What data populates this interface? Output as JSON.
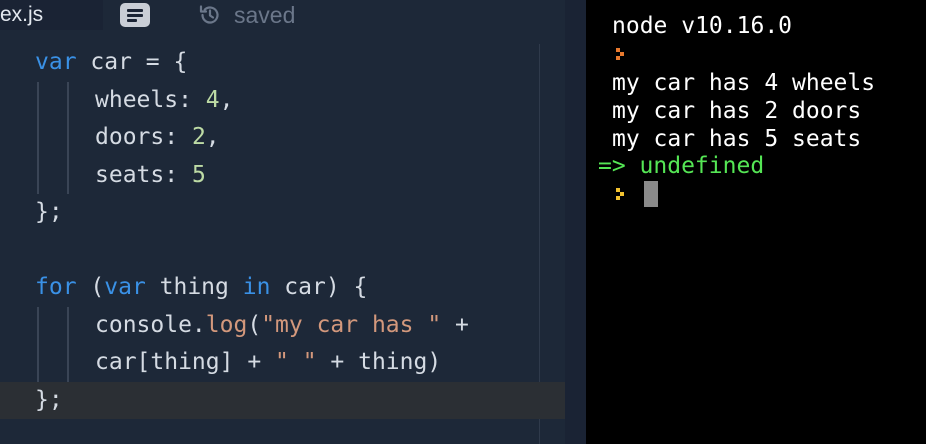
{
  "editor": {
    "active_tab": "ex.js",
    "saved_label": "saved",
    "lines": [
      {
        "tokens": [
          {
            "t": "var",
            "c": "kw"
          },
          {
            "t": " car = {",
            "c": "plain"
          }
        ]
      },
      {
        "tokens": [
          {
            "t": "wheels: ",
            "c": "plain"
          },
          {
            "t": "4",
            "c": "num"
          },
          {
            "t": ",",
            "c": "plain"
          }
        ]
      },
      {
        "tokens": [
          {
            "t": "doors: ",
            "c": "plain"
          },
          {
            "t": "2",
            "c": "num"
          },
          {
            "t": ",",
            "c": "plain"
          }
        ]
      },
      {
        "tokens": [
          {
            "t": "seats: ",
            "c": "plain"
          },
          {
            "t": "5",
            "c": "num"
          }
        ]
      },
      {
        "tokens": [
          {
            "t": "};",
            "c": "plain"
          }
        ]
      },
      {
        "tokens": []
      },
      {
        "tokens": [
          {
            "t": "for",
            "c": "kw"
          },
          {
            "t": " (",
            "c": "plain"
          },
          {
            "t": "var",
            "c": "kw"
          },
          {
            "t": " thing ",
            "c": "plain"
          },
          {
            "t": "in",
            "c": "kw"
          },
          {
            "t": " car) {",
            "c": "plain"
          }
        ]
      },
      {
        "tokens": [
          {
            "t": "console.",
            "c": "plain"
          },
          {
            "t": "log",
            "c": "str"
          },
          {
            "t": "(",
            "c": "plain"
          },
          {
            "t": "\"my car has \"",
            "c": "str"
          },
          {
            "t": " +",
            "c": "plain"
          }
        ]
      },
      {
        "tokens": [
          {
            "t": "car[thing] + ",
            "c": "plain"
          },
          {
            "t": "\" \"",
            "c": "str"
          },
          {
            "t": " + thing)",
            "c": "plain"
          }
        ]
      },
      {
        "tokens": [
          {
            "t": "};",
            "c": "plain"
          }
        ]
      }
    ]
  },
  "console": {
    "version": "node v10.16.0",
    "output_lines": [
      "my car has 4 wheels",
      "my car has 2 doors",
      "my car has 5 seats"
    ],
    "result": "=> undefined"
  },
  "colors": {
    "keyword": "#3a91e6",
    "number": "#bddba5",
    "string": "#d3987c",
    "result": "#55e655",
    "prompt_first": "#e8792e",
    "prompt_active": "#f2c230"
  },
  "icons": {
    "document": "document-icon",
    "saved": "history-icon",
    "prompt": "prompt-chevron-icon"
  }
}
